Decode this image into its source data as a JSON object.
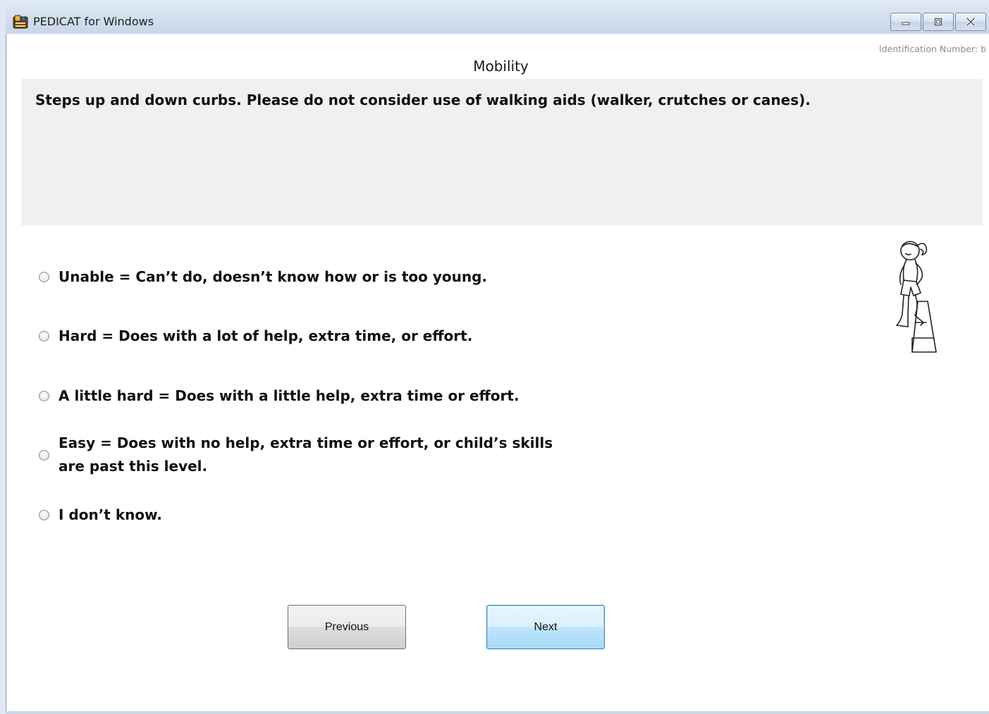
{
  "window": {
    "title": "PEDICAT for Windows",
    "app_icon": "pedicat-app-icon",
    "controls": {
      "minimize_icon": "minimize-icon",
      "maximize_icon": "maximize-icon",
      "close_icon": "close-icon"
    }
  },
  "header": {
    "identification": "Identification Number: b",
    "category": "Mobility"
  },
  "question": {
    "text": "Steps up and down curbs. Please do not consider use of walking aids (walker, crutches or canes)."
  },
  "options": [
    {
      "label": "Unable = Can’t do, doesn’t know how or is too young.",
      "selected": false
    },
    {
      "label": "Hard = Does with a lot of help, extra time, or effort.",
      "selected": false
    },
    {
      "label": "A little hard = Does with a little help, extra time or effort.",
      "selected": false
    },
    {
      "label_line1": "Easy = Does with no help, extra time or effort, or child’s skills",
      "label_line2": "are past this level.",
      "selected": false
    },
    {
      "label": "I don’t know.",
      "selected": false
    }
  ],
  "navigation": {
    "previous_label": "Previous",
    "next_label": "Next"
  },
  "illustration": {
    "icon": "girl-stepping-on-curb-illustration"
  },
  "colors": {
    "titlebar": "#cfdcec",
    "question_background": "#f0f0f0",
    "focused_button_border": "#3c7fb1"
  }
}
